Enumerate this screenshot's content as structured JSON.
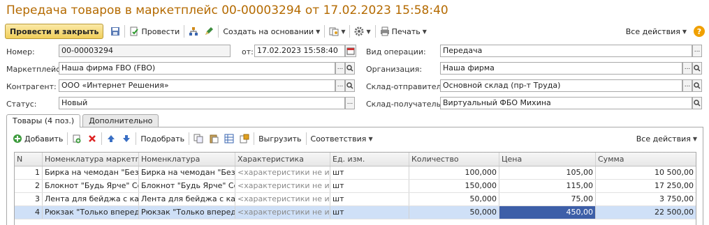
{
  "title": "Передача товаров в маркетплейс 00-00003294 от 17.02.2023 15:58:40",
  "toolbar": {
    "post_close": "Провести и закрыть",
    "post": "Провести",
    "create_based": "Создать на основании",
    "print": "Печать",
    "all_actions": "Все действия",
    "help": "?"
  },
  "form": {
    "number_label": "Номер:",
    "number_value": "00-00003294",
    "date_label": "от:",
    "date_value": "17.02.2023 15:58:40",
    "op_type_label": "Вид операции:",
    "op_type_value": "Передача",
    "marketplace_label": "Маркетплейс:",
    "marketplace_value": "Наша фирма FBO (FBO)",
    "org_label": "Организация:",
    "org_value": "Наша фирма",
    "counterparty_label": "Контрагент:",
    "counterparty_value": "ООО «Интернет Решения»",
    "sender_label": "Склад-отправитель:",
    "sender_value": "Основной склад (пр-т Труда)",
    "status_label": "Статус:",
    "status_value": "Новый",
    "receiver_label": "Склад-получатель:",
    "receiver_value": "Виртуальный ФБО Михина"
  },
  "tabs": [
    "Товары (4 поз.)",
    "Дополнительно"
  ],
  "table_toolbar": {
    "add": "Добавить",
    "select": "Подобрать",
    "upload": "Выгрузить",
    "mapping": "Соответствия",
    "all_actions": "Все действия"
  },
  "table": {
    "headers": [
      "N",
      "Номенклатура маркетпл...",
      "Номенклатура",
      "Характеристика",
      "Ед. изм.",
      "Количество",
      "Цена",
      "Сумма"
    ],
    "rows": [
      [
        "1",
        "Бирка на чемодан \"Без ...",
        "Бирка на чемодан \"Без ...",
        "<характеристики не исп...",
        "шт",
        "100,000",
        "105,00",
        "10 500,00"
      ],
      [
        "2",
        "Блокнот \"Будь Ярче\" Со...",
        "Блокнот \"Будь Ярче\" Со...",
        "<характеристики не исп...",
        "шт",
        "150,000",
        "115,00",
        "17 250,00"
      ],
      [
        "3",
        "Лента для бейджа с кар...",
        "Лента для бейджа с кар...",
        "<характеристики не исп...",
        "шт",
        "50,000",
        "75,00",
        "3 750,00"
      ],
      [
        "4",
        "Рюкзак \"Только вперед...",
        "Рюкзак \"Только вперед...",
        "<характеристики не исп...",
        "шт",
        "50,000",
        "450,00",
        "22 500,00"
      ]
    ]
  },
  "colors": {
    "title": "#b46a00",
    "selected_row": "#cfe0f7",
    "focused_cell": "#3d5fa8",
    "primary_button": "#f1cf5a"
  }
}
